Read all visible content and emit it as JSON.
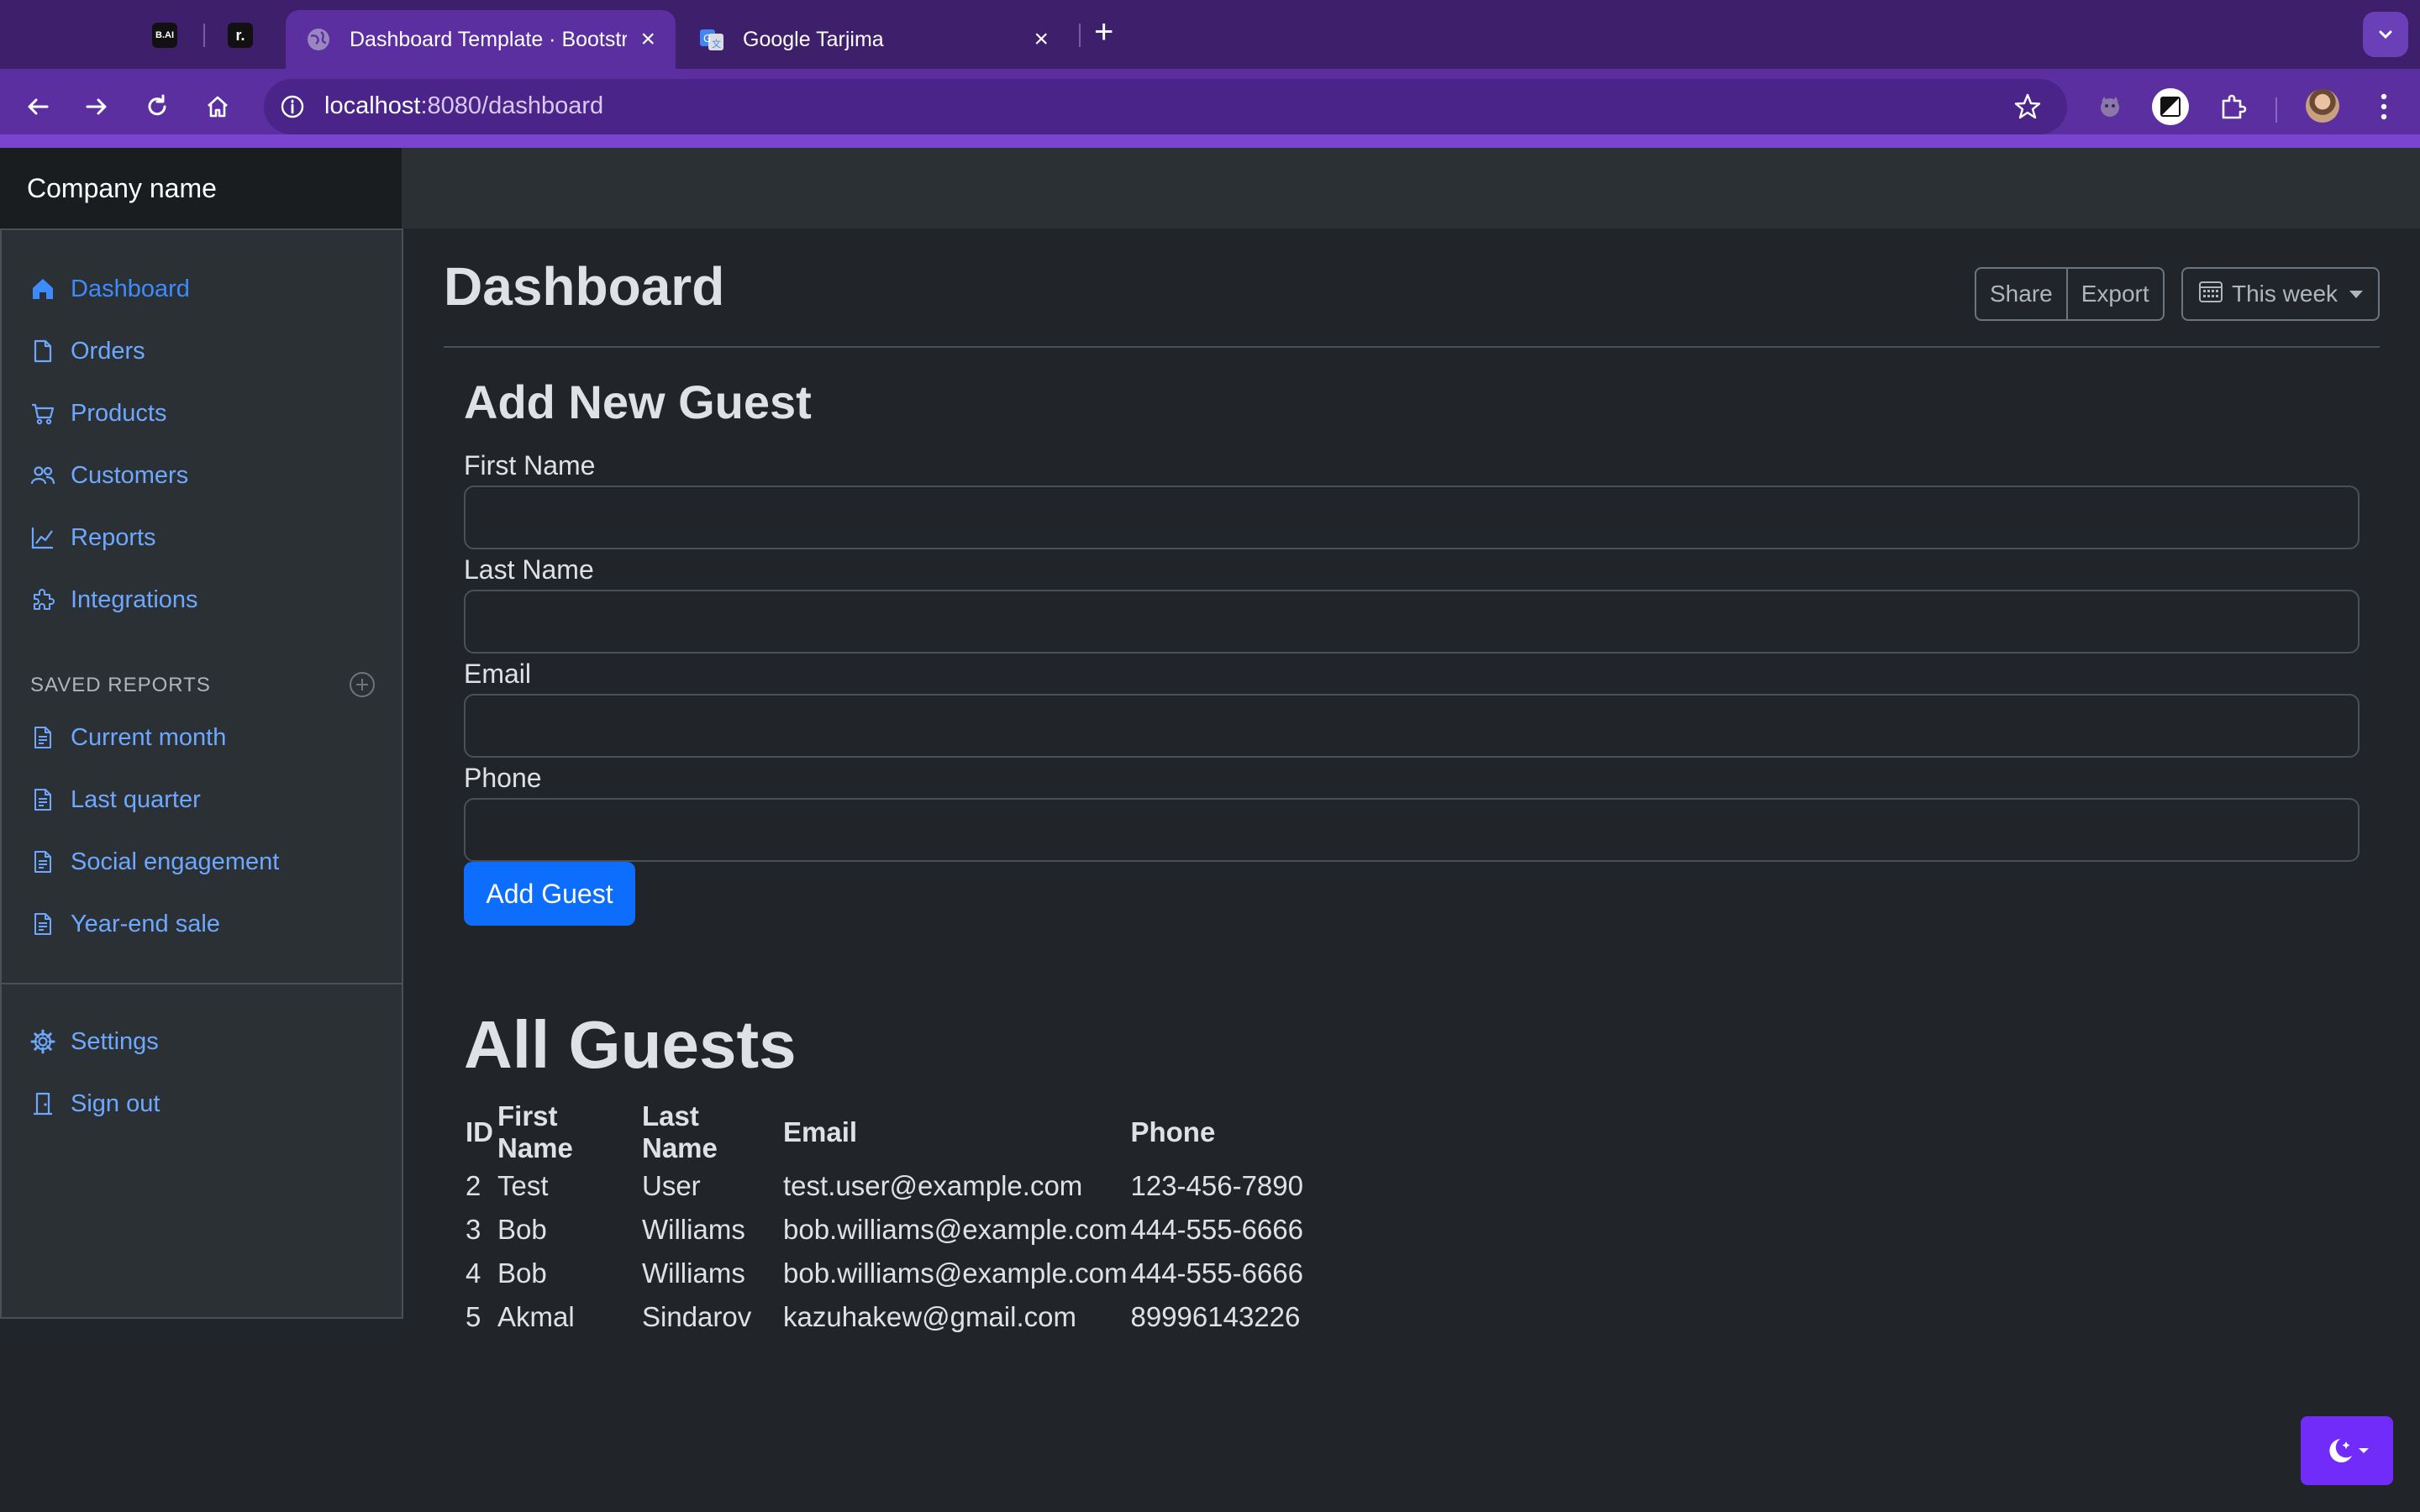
{
  "browser": {
    "pinned_tabs": [
      {
        "label": "B.AI"
      },
      {
        "label": "r."
      }
    ],
    "tabs": [
      {
        "title": "Dashboard Template · Bootstrap",
        "active": true
      },
      {
        "title": "Google Tarjima",
        "active": false
      }
    ],
    "url_host": "localhost",
    "url_path": ":8080/dashboard",
    "icons": [
      "back-icon",
      "forward-icon",
      "reload-icon",
      "home-icon",
      "info-icon",
      "star-icon",
      "extension-icon",
      "profile-avatar",
      "menu-icon"
    ]
  },
  "header": {
    "brand": "Company name"
  },
  "sidebar": {
    "items": [
      {
        "label": "Dashboard",
        "icon": "house-icon",
        "active": true
      },
      {
        "label": "Orders",
        "icon": "file-icon"
      },
      {
        "label": "Products",
        "icon": "cart-icon"
      },
      {
        "label": "Customers",
        "icon": "people-icon"
      },
      {
        "label": "Reports",
        "icon": "graph-icon"
      },
      {
        "label": "Integrations",
        "icon": "puzzle-icon"
      }
    ],
    "saved_heading": "SAVED REPORTS",
    "saved": [
      {
        "label": "Current month"
      },
      {
        "label": "Last quarter"
      },
      {
        "label": "Social engagement"
      },
      {
        "label": "Year-end sale"
      }
    ],
    "footer": [
      {
        "label": "Settings",
        "icon": "gear-icon"
      },
      {
        "label": "Sign out",
        "icon": "door-icon"
      }
    ]
  },
  "main": {
    "title": "Dashboard",
    "share_label": "Share",
    "export_label": "Export",
    "week_label": "This week",
    "form": {
      "title": "Add New Guest",
      "first_name_label": "First Name",
      "last_name_label": "Last Name",
      "email_label": "Email",
      "phone_label": "Phone",
      "first_name_value": "",
      "last_name_value": "",
      "email_value": "",
      "phone_value": "",
      "submit_label": "Add Guest"
    },
    "guests": {
      "title": "All Guests",
      "columns": [
        "ID",
        "First Name",
        "Last Name",
        "Email",
        "Phone"
      ],
      "rows": [
        [
          "2",
          "Test",
          "User",
          "test.user@example.com",
          "123-456-7890"
        ],
        [
          "3",
          "Bob",
          "Williams",
          "bob.williams@example.com",
          "444-555-6666"
        ],
        [
          "4",
          "Bob",
          "Williams",
          "bob.williams@example.com",
          "444-555-6666"
        ],
        [
          "5",
          "Akmal",
          "Sindarov",
          "kazuhakew@gmail.com",
          "89996143226"
        ]
      ]
    }
  },
  "colors": {
    "tabbar": "#3d1f6b",
    "toolbar": "#5b2fa0",
    "link": "#6ea8fe",
    "primary": "#0d6efd",
    "theme_toggle": "#712cf9"
  }
}
